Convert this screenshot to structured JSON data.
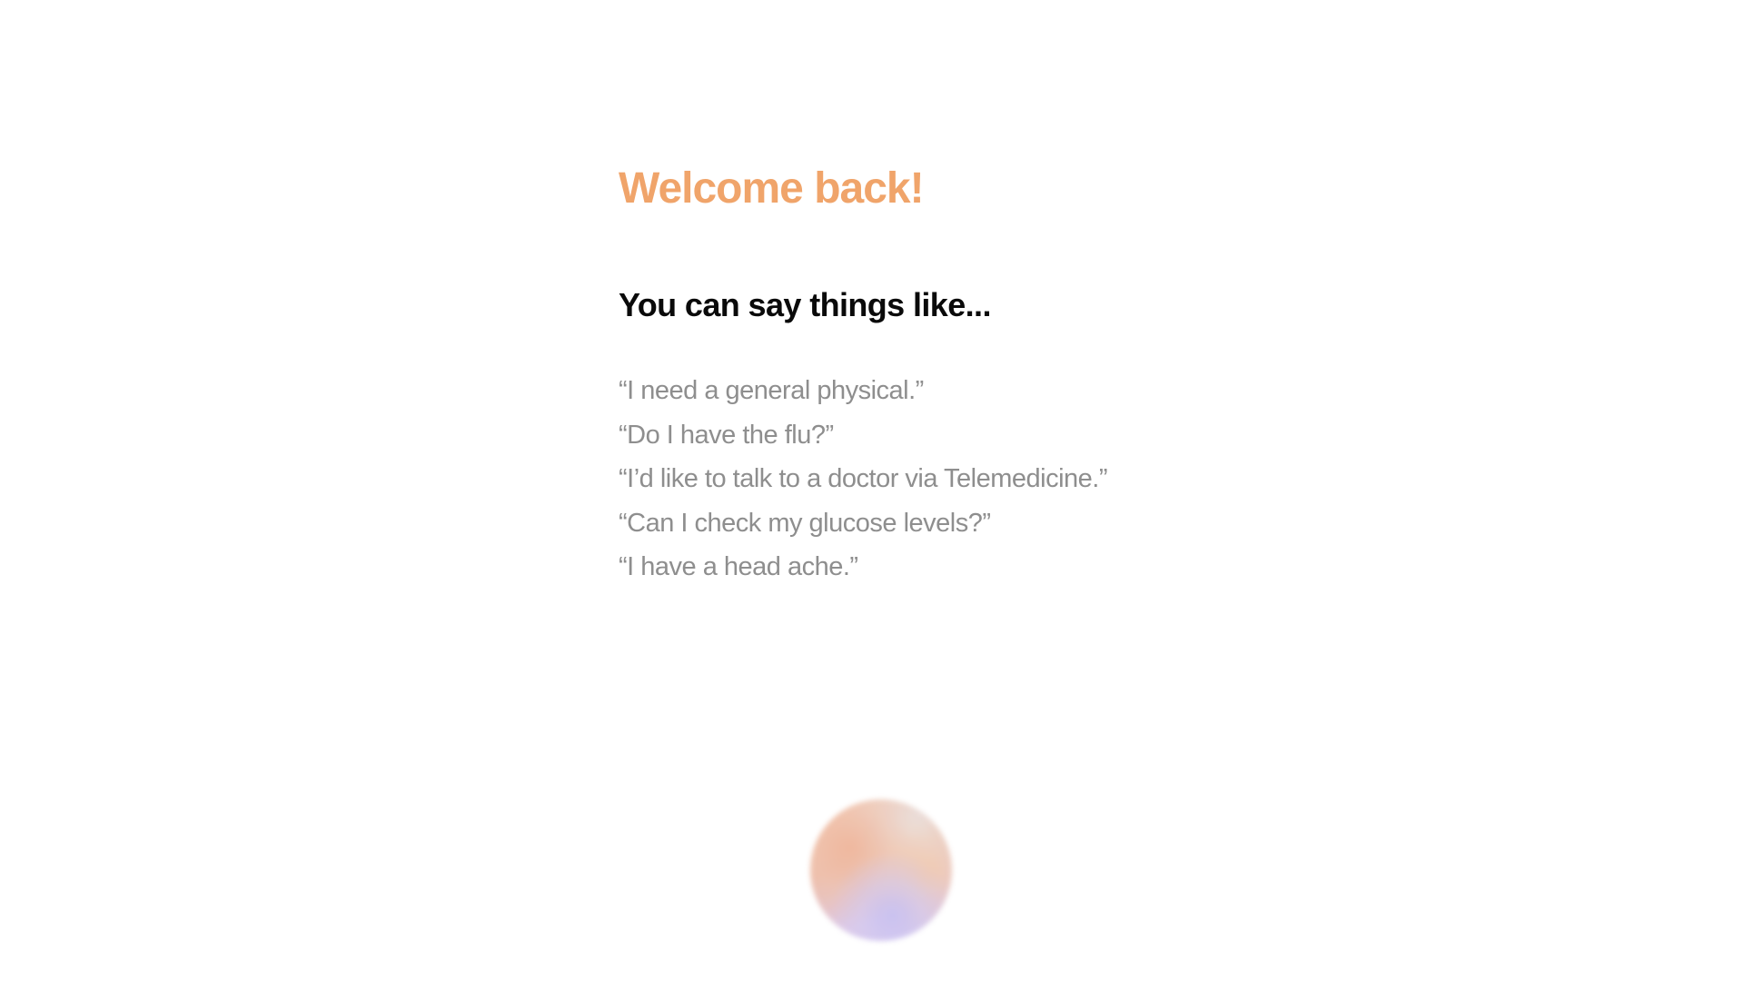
{
  "welcome": {
    "title": "Welcome back!"
  },
  "prompt": {
    "heading": "You can say things like...",
    "examples": [
      "“I need a general physical.”",
      "“Do I have the flu?”",
      "“I’d like to talk to a doctor via Telemedicine.”",
      "“Can I check my glucose levels?”",
      "“I have a head ache.”"
    ]
  },
  "colors": {
    "accent": "#F0A46A",
    "heading": "#0a0a0a",
    "example_text": "#8e8e8e",
    "background": "#ffffff"
  },
  "voice_orb": {
    "icon": "voice-assistant-orb-icon"
  }
}
